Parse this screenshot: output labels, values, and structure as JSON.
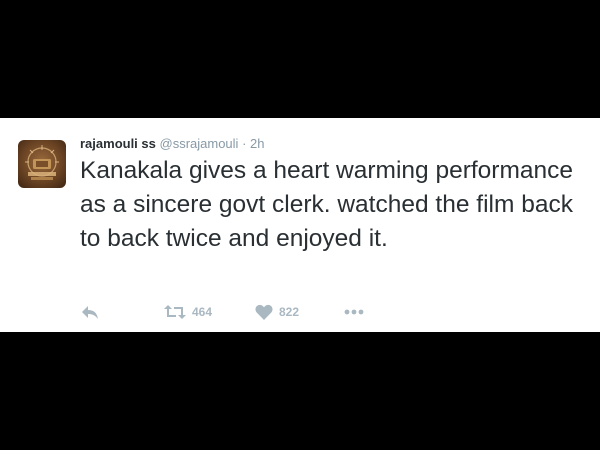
{
  "tweet": {
    "user_name": "rajamouli ss",
    "handle": "@ssrajamouli",
    "separator": "·",
    "time": "2h",
    "text": "Kanakala gives a heart warming performance as a sincere govt clerk. watched the film back to back twice and enjoyed it.",
    "retweet_count": "464",
    "like_count": "822"
  },
  "icons": {
    "avatar": "profile-emblem",
    "reply": "reply-icon",
    "retweet": "retweet-icon",
    "like": "heart-icon",
    "more": "more-dots-icon"
  },
  "colors": {
    "background": "#000000",
    "card": "#ffffff",
    "text": "#292f33",
    "muted": "#8899a6",
    "icon": "#aab8c2"
  }
}
